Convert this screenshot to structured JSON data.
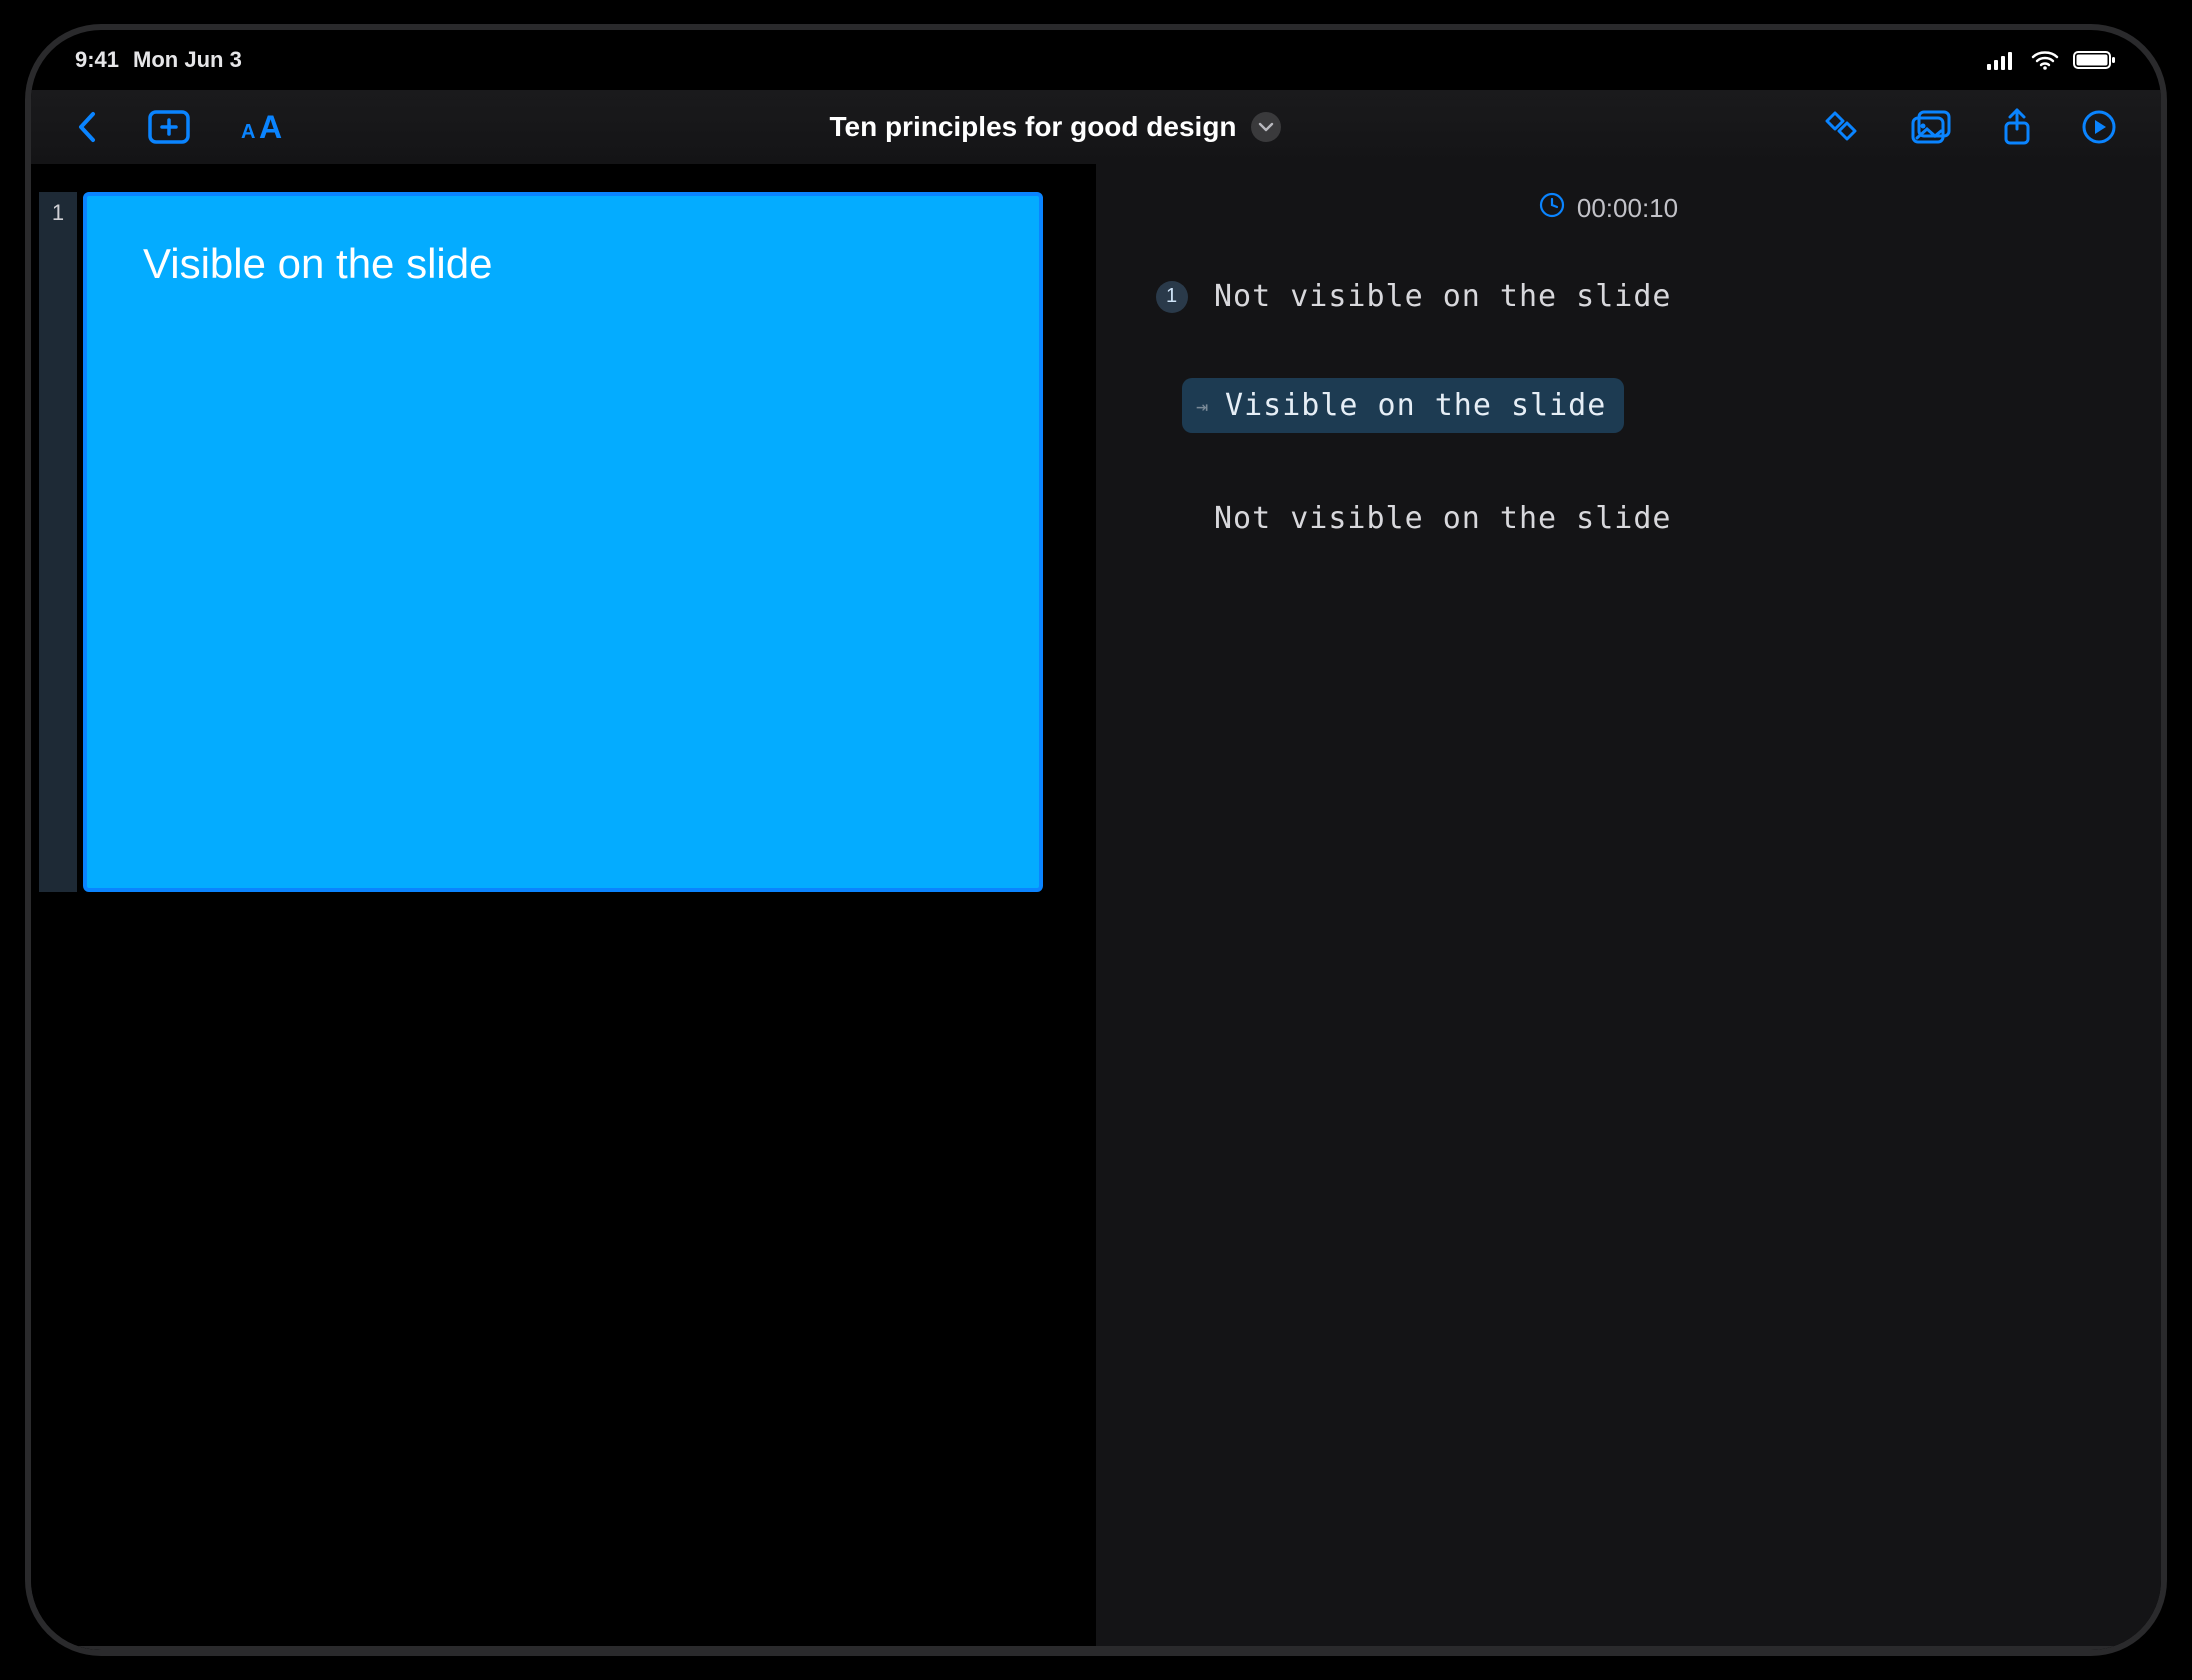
{
  "statusbar": {
    "time": "9:41",
    "date": "Mon Jun 3"
  },
  "toolbar": {
    "title": "Ten principles for good design"
  },
  "slide": {
    "number": "1",
    "body_text": "Visible on the slide"
  },
  "teleprompter": {
    "timer": "00:00:10",
    "lines": [
      {
        "badge": "1",
        "text": "Not visible on the slide",
        "highlight": false
      },
      {
        "badge": "",
        "text": "Visible on the slide",
        "highlight": true
      },
      {
        "badge": "",
        "text": "Not visible on the slide",
        "highlight": false
      }
    ]
  },
  "colors": {
    "accent": "#0a84ff",
    "slide_fill": "#04acff"
  }
}
